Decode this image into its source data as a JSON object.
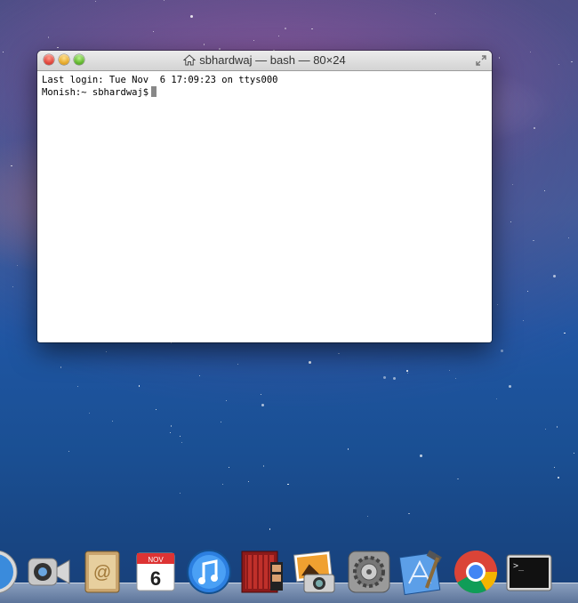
{
  "window": {
    "title": "sbhardwaj — bash — 80×24",
    "lines": [
      "Last login: Tue Nov  6 17:09:23 on ttys000",
      "Monish:~ sbhardwaj$"
    ]
  },
  "dock": {
    "calendar": {
      "month": "NOV",
      "day": "6"
    }
  },
  "colors": {
    "close": "#e0443a",
    "minimize": "#e6a92a",
    "maximize": "#5fb52c"
  }
}
